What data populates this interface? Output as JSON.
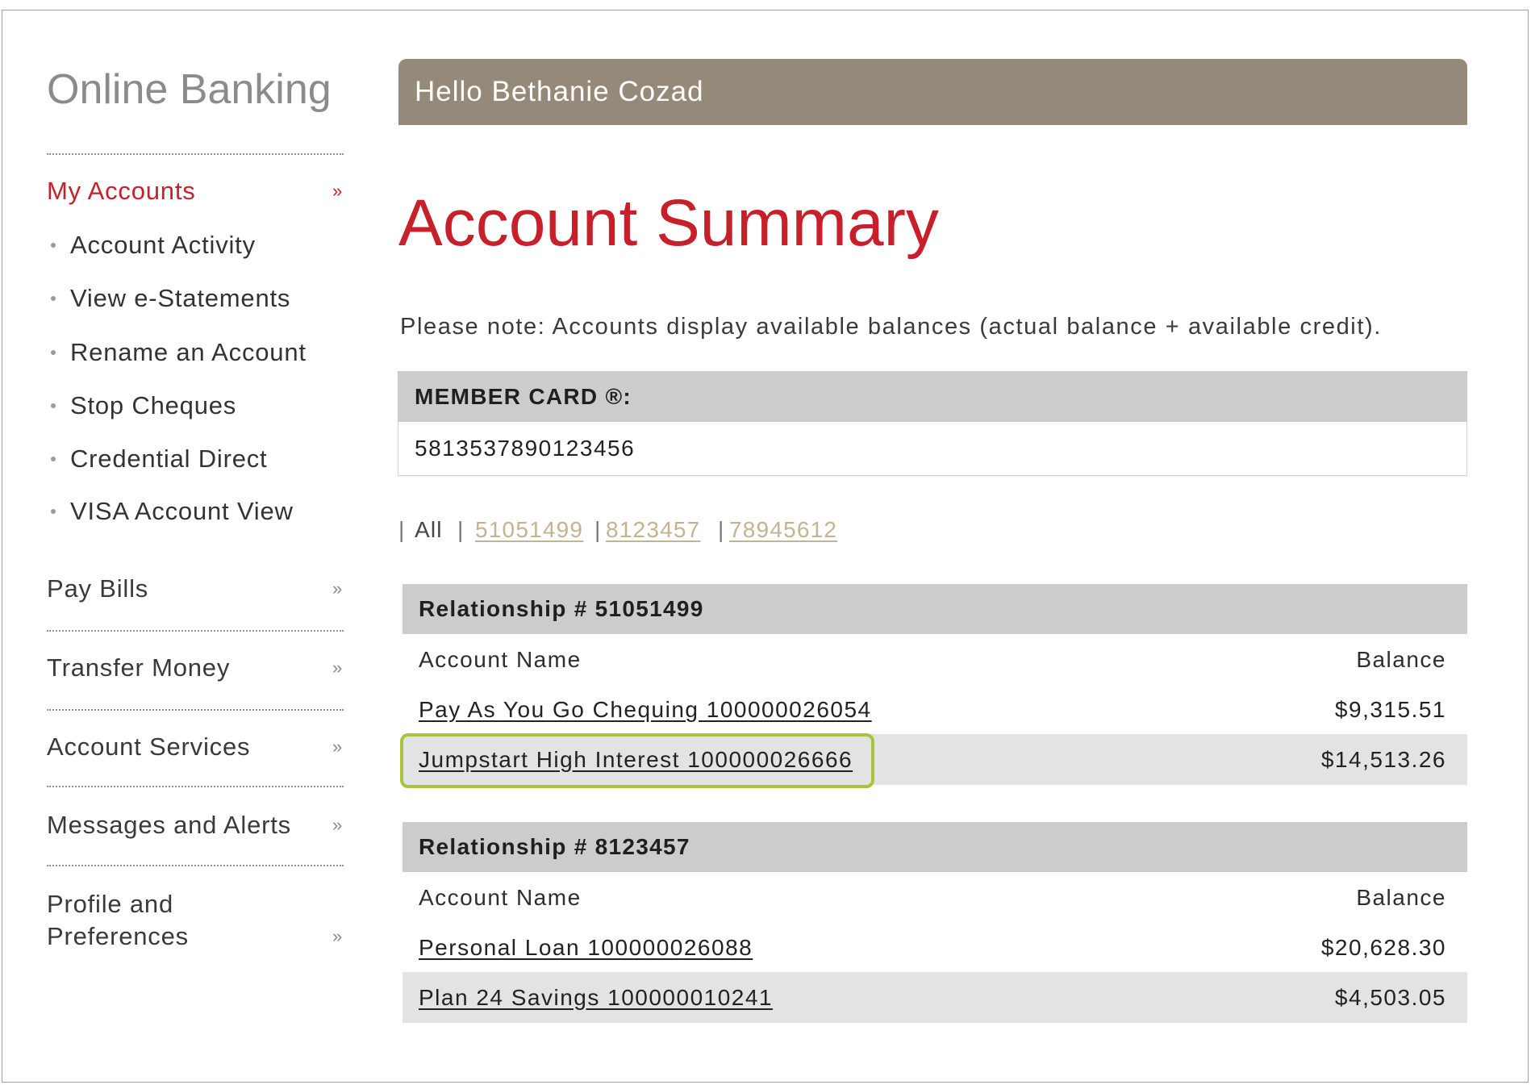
{
  "sidebar": {
    "brand": "Online Banking",
    "my_accounts": {
      "label": "My Accounts",
      "chevron": "»",
      "sub_items": [
        "Account Activity",
        "View e-Statements",
        "Rename an Account",
        "Stop Cheques",
        "Credential Direct",
        "VISA Account View"
      ]
    },
    "sections": [
      {
        "label": "Pay Bills",
        "chevron": "»"
      },
      {
        "label": "Transfer Money",
        "chevron": "»"
      },
      {
        "label": "Account Services",
        "chevron": "»"
      },
      {
        "label": "Messages and Alerts",
        "chevron": "»"
      },
      {
        "label_line1": "Profile and",
        "label_line2": "Preferences",
        "chevron": "»"
      }
    ]
  },
  "header": {
    "greeting": "Hello Bethanie Cozad"
  },
  "page_title": "Account Summary",
  "note": "Please note: Accounts display available balances (actual balance + available credit).",
  "member_card": {
    "label": "MEMBER CARD ®:",
    "number": "5813537890123456"
  },
  "filter": {
    "separator": "|",
    "all_label": "All",
    "links": [
      "51051499",
      "8123457",
      "78945612"
    ]
  },
  "relationships": [
    {
      "title": "Relationship # 51051499",
      "col_name": "Account Name",
      "col_balance": "Balance",
      "accounts": [
        {
          "name": "Pay As You Go Chequing 100000026054",
          "balance": "$9,315.51"
        },
        {
          "name": "Jumpstart High Interest 100000026666",
          "balance": "$14,513.26",
          "highlighted": true
        }
      ]
    },
    {
      "title": "Relationship # 8123457",
      "col_name": "Account Name",
      "col_balance": "Balance",
      "accounts": [
        {
          "name": "Personal Loan 100000026088",
          "balance": "$20,628.30"
        },
        {
          "name": "Plan 24 Savings 100000010241",
          "balance": "$4,503.05"
        }
      ]
    }
  ],
  "icons": {
    "nav_chevron": "chevron-double-right-icon",
    "sub_bullet": "bullet-icon"
  },
  "colors": {
    "accent_red": "#c8202a",
    "header_bar": "#958979",
    "link_tan": "#c4b390",
    "highlight_green": "#a7c43c",
    "table_header": "#cccccc",
    "row_stripe": "#e3e3e3"
  }
}
